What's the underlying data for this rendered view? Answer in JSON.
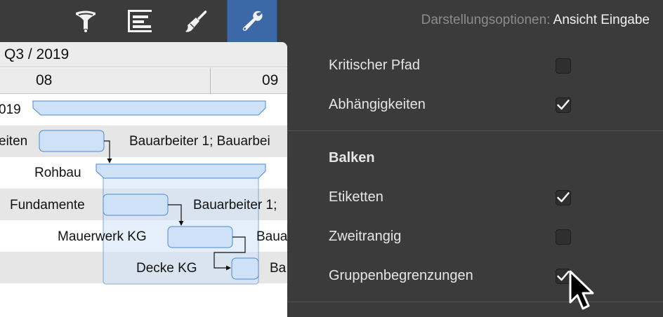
{
  "toolbar": {
    "buttons": [
      {
        "icon": "filter-icon",
        "active": false
      },
      {
        "icon": "gantt-bars-icon",
        "active": false
      },
      {
        "icon": "brush-icon",
        "active": false
      },
      {
        "icon": "wrench-icon",
        "active": true
      }
    ],
    "title_label": "Darstellungsoptionen:",
    "title_value": "Ansicht Eingabe",
    "active_color": "#3d68a8"
  },
  "gantt": {
    "quarter": "Q3 / 2019",
    "months": [
      "08",
      "09"
    ],
    "rows": [
      {
        "label": "019"
      },
      {
        "label": "eiten",
        "resource": "Bauarbeiter 1; Bauarbei"
      },
      {
        "label": "Rohbau"
      },
      {
        "label": "Fundamente",
        "resource": "Bauarbeiter 1;"
      },
      {
        "label": "Mauerwerk KG",
        "resource": "Baua"
      },
      {
        "label": "Decke KG",
        "resource": "Ba"
      }
    ],
    "bar_color": "#cfe1f7",
    "bar_border": "#4a8ad6"
  },
  "options": {
    "critical_path": {
      "label": "Kritischer Pfad",
      "checked": false
    },
    "dependencies": {
      "label": "Abhängigkeiten",
      "checked": true
    },
    "bars_heading": "Balken",
    "labels": {
      "label": "Etiketten",
      "checked": true
    },
    "secondary": {
      "label": "Zweitrangig",
      "checked": false
    },
    "group_bounds": {
      "label": "Gruppenbegrenzungen",
      "checked": true
    }
  }
}
